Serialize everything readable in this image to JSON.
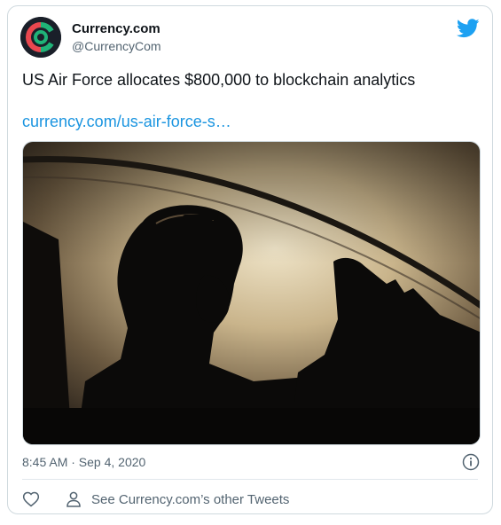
{
  "account": {
    "name": "Currency.com",
    "handle": "@CurrencyCom",
    "avatar_icon": "currency-com-logo",
    "logo_colors": [
      "#e9474f",
      "#1fb378"
    ]
  },
  "tweet": {
    "text": "US Air Force allocates $800,000 to blockchain analytics",
    "link_text": "currency.com/us-air-force-s…",
    "timestamp": "8:45 AM · Sep 4, 2020",
    "media_subject": "fighter-pilot-silhouette-photo"
  },
  "footer": {
    "like_icon": "heart-icon",
    "more_tweets_icon": "user-icon",
    "more_tweets_label": "See Currency.com’s other Tweets"
  },
  "colors": {
    "link": "#1b95e0",
    "twitter_blue": "#1da1f2",
    "muted_text": "#536471",
    "border": "#cfd9de"
  }
}
